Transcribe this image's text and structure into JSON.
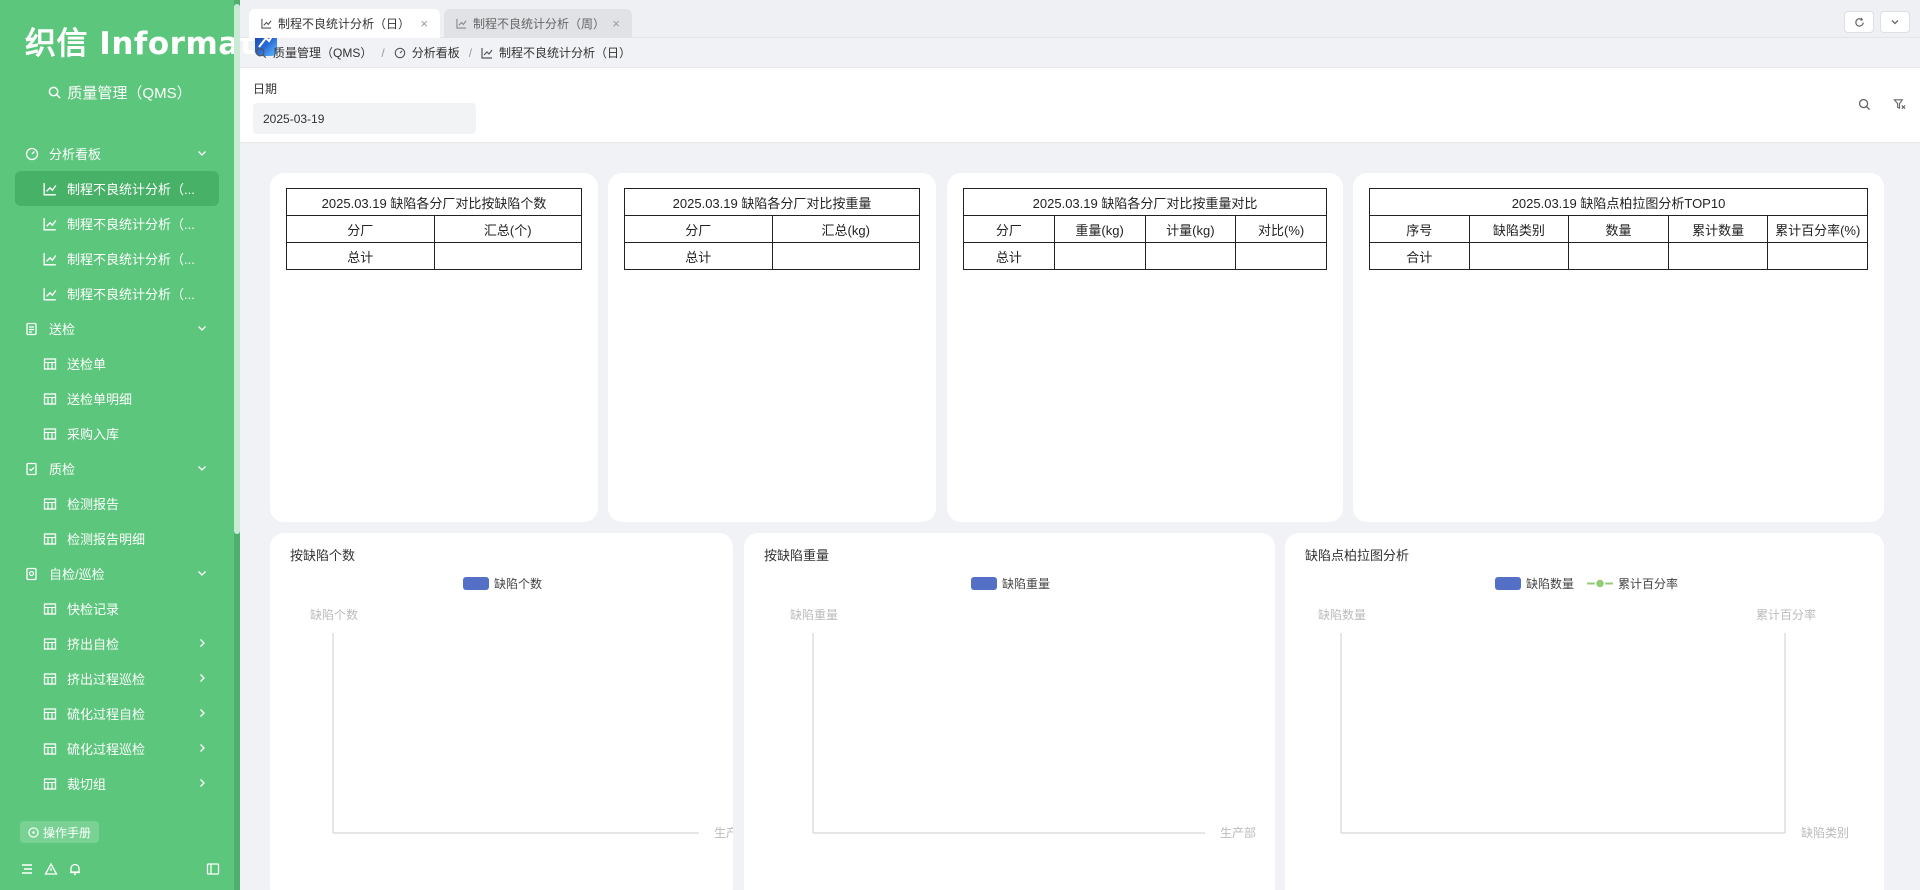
{
  "sidebar": {
    "logo_text": "织信 Informat",
    "app_title": "质量管理（QMS）",
    "menu": [
      {
        "kind": "group",
        "label": "分析看板",
        "icon": "dashboard-icon",
        "caret": "down"
      },
      {
        "kind": "item",
        "label": "制程不良统计分析（...",
        "icon": "chart-line-icon",
        "active": true
      },
      {
        "kind": "item",
        "label": "制程不良统计分析（...",
        "icon": "chart-line-icon"
      },
      {
        "kind": "item",
        "label": "制程不良统计分析（...",
        "icon": "chart-line-icon"
      },
      {
        "kind": "item",
        "label": "制程不良统计分析（...",
        "icon": "chart-line-icon"
      },
      {
        "kind": "group",
        "label": "送检",
        "icon": "document-list-icon",
        "caret": "down"
      },
      {
        "kind": "item",
        "label": "送检单",
        "icon": "table-icon"
      },
      {
        "kind": "item",
        "label": "送检单明细",
        "icon": "table-icon"
      },
      {
        "kind": "item",
        "label": "采购入库",
        "icon": "table-icon"
      },
      {
        "kind": "group",
        "label": "质检",
        "icon": "document-check-icon",
        "caret": "down"
      },
      {
        "kind": "item",
        "label": "检测报告",
        "icon": "table-icon"
      },
      {
        "kind": "item",
        "label": "检测报告明细",
        "icon": "table-icon"
      },
      {
        "kind": "group",
        "label": "自检/巡检",
        "icon": "document-search-icon",
        "caret": "down"
      },
      {
        "kind": "item",
        "label": "快检记录",
        "icon": "table-icon"
      },
      {
        "kind": "item",
        "label": "挤出自检",
        "icon": "table-icon",
        "caret": "right"
      },
      {
        "kind": "item",
        "label": "挤出过程巡检",
        "icon": "table-icon",
        "caret": "right"
      },
      {
        "kind": "item",
        "label": "硫化过程自检",
        "icon": "table-icon",
        "caret": "right"
      },
      {
        "kind": "item",
        "label": "硫化过程巡检",
        "icon": "table-icon",
        "caret": "right"
      },
      {
        "kind": "item",
        "label": "裁切组",
        "icon": "table-icon",
        "caret": "right"
      }
    ],
    "manual_label": "操作手册"
  },
  "tabs": [
    {
      "label": "制程不良统计分析（日）",
      "active": true
    },
    {
      "label": "制程不良统计分析（周）",
      "active": false
    }
  ],
  "breadcrumb": [
    "质量管理（QMS）",
    "分析看板",
    "制程不良统计分析（日）"
  ],
  "filter": {
    "label": "日期",
    "value": "2025-03-19"
  },
  "tables": [
    {
      "title": "2025.03.19 缺陷各分厂对比按缺陷个数",
      "headers": [
        "分厂",
        "汇总(个)"
      ],
      "rows": [
        [
          "总计",
          ""
        ]
      ]
    },
    {
      "title": "2025.03.19 缺陷各分厂对比按重量",
      "headers": [
        "分厂",
        "汇总(kg)"
      ],
      "rows": [
        [
          "总计",
          ""
        ]
      ]
    },
    {
      "title": "2025.03.19 缺陷各分厂对比按重量对比",
      "headers": [
        "分厂",
        "重量(kg)",
        "计量(kg)",
        "对比(%)"
      ],
      "rows": [
        [
          "总计",
          "",
          "",
          ""
        ]
      ]
    },
    {
      "title": "2025.03.19 缺陷点柏拉图分析TOP10",
      "headers": [
        "序号",
        "缺陷类别",
        "数量",
        "累计数量",
        "累计百分率(%)"
      ],
      "rows": [
        [
          "合计",
          "",
          "",
          "",
          ""
        ]
      ]
    }
  ],
  "charts": [
    {
      "title": "按缺陷个数",
      "legend": [
        "缺陷个数"
      ],
      "y_label": "缺陷个数",
      "x_label": "生产厂"
    },
    {
      "title": "按缺陷重量",
      "legend": [
        "缺陷重量"
      ],
      "y_label": "缺陷重量",
      "x_label": "生产部"
    },
    {
      "title": "缺陷点柏拉图分析",
      "legend": [
        "缺陷数量",
        "累计百分率"
      ],
      "y_label": "缺陷数量",
      "y2_label": "累计百分率",
      "x_label": "缺陷类别"
    }
  ],
  "chart_data": [
    {
      "type": "bar",
      "title": "按缺陷个数",
      "series": [
        {
          "name": "缺陷个数",
          "values": []
        }
      ],
      "categories": [],
      "ylabel": "缺陷个数",
      "xlabel": "生产厂"
    },
    {
      "type": "bar",
      "title": "按缺陷重量",
      "series": [
        {
          "name": "缺陷重量",
          "values": []
        }
      ],
      "categories": [],
      "ylabel": "缺陷重量",
      "xlabel": "生产部"
    },
    {
      "type": "bar",
      "title": "缺陷点柏拉图分析",
      "series": [
        {
          "name": "缺陷数量",
          "values": []
        },
        {
          "name": "累计百分率",
          "values": []
        }
      ],
      "categories": [],
      "ylabel": "缺陷数量",
      "y2label": "累计百分率",
      "xlabel": "缺陷类别"
    }
  ],
  "colors": {
    "sidebar": "#5cc77c",
    "bar_series": "#5470c6",
    "line_series": "#91cc75"
  }
}
